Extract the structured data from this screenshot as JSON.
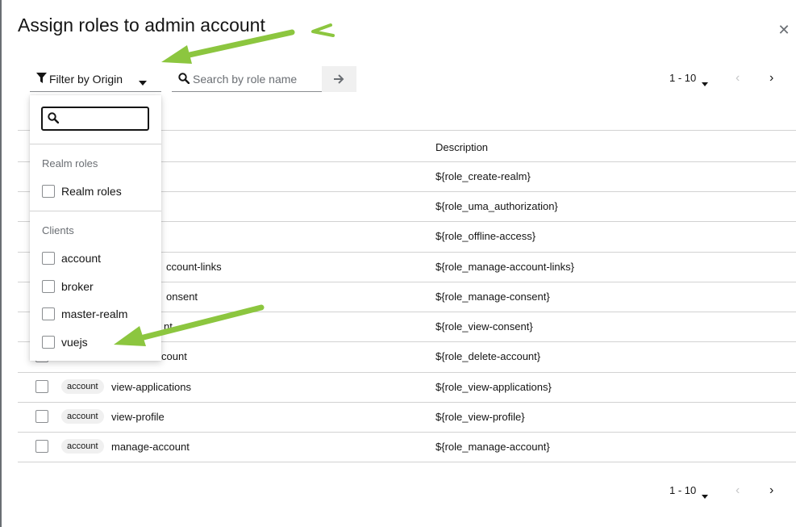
{
  "modal": {
    "title": "Assign roles to admin account",
    "close_icon": "close-icon"
  },
  "toolbar": {
    "filter_label": "Filter by Origin",
    "search_placeholder": "Search by role name",
    "search_value": "",
    "search_icon": "search-icon",
    "go_icon": "arrow-right-icon"
  },
  "pagination": {
    "top_range": "1 - 10",
    "bottom_range": "1 - 10"
  },
  "filter_menu": {
    "search_value": "",
    "groups": [
      {
        "heading": "Realm roles",
        "options": [
          "Realm roles"
        ]
      },
      {
        "heading": "Clients",
        "options": [
          "account",
          "broker",
          "master-realm",
          "vuejs"
        ]
      }
    ]
  },
  "table": {
    "header_description": "Description",
    "rows": [
      {
        "badge": "",
        "name": "",
        "description": "${role_create-realm}"
      },
      {
        "badge": "",
        "name": "",
        "description": "${role_uma_authorization}"
      },
      {
        "badge": "",
        "name": "",
        "description": "${role_offline-access}"
      },
      {
        "badge": "",
        "name": "ccount-links",
        "description": "${role_manage-account-links}"
      },
      {
        "badge": "",
        "name": "onsent",
        "description": "${role_manage-consent}"
      },
      {
        "badge": "",
        "name": "nt",
        "description": "${role_view-consent}"
      },
      {
        "badge": "",
        "name": "count",
        "description": "${role_delete-account}"
      },
      {
        "badge": "account",
        "name": "view-applications",
        "description": "${role_view-applications}"
      },
      {
        "badge": "account",
        "name": "view-profile",
        "description": "${role_view-profile}"
      },
      {
        "badge": "account",
        "name": "manage-account",
        "description": "${role_manage-account}"
      }
    ]
  },
  "annotations": {
    "arrow_color": "#8cc63f"
  }
}
